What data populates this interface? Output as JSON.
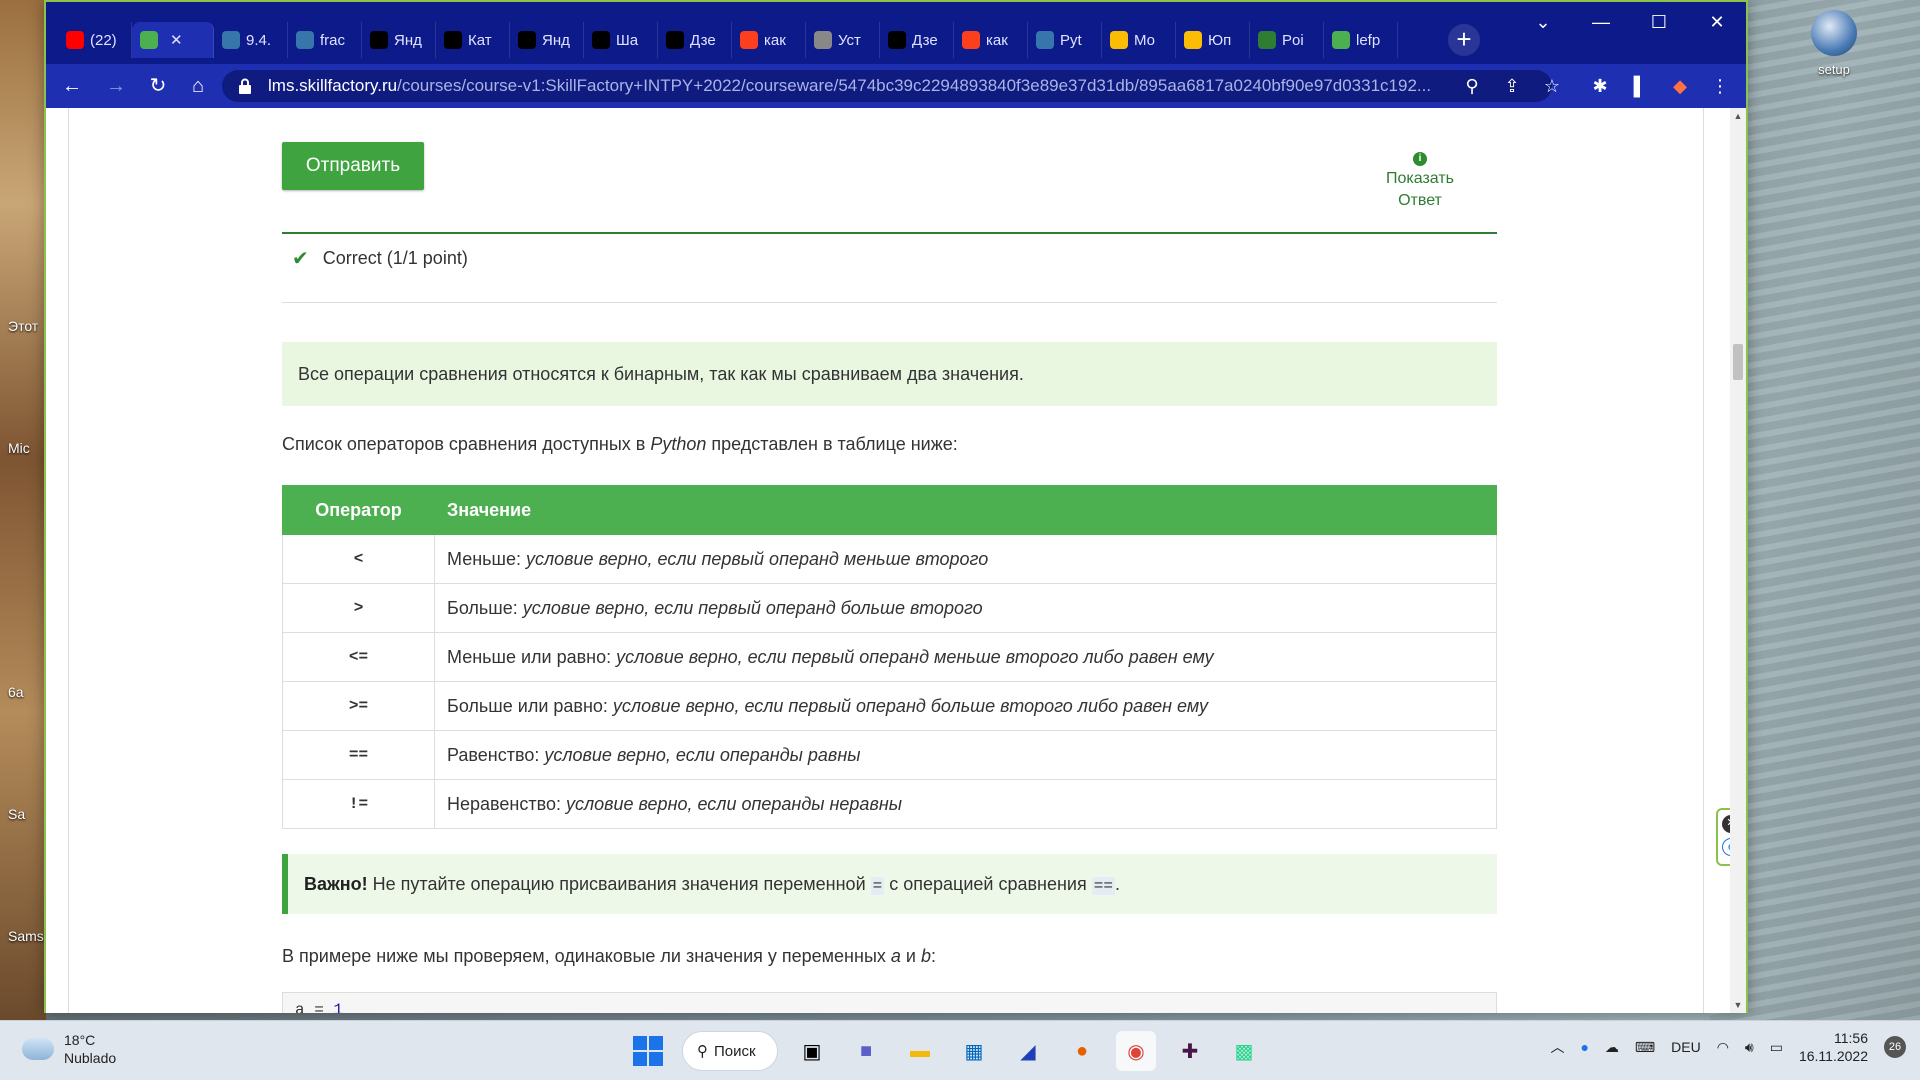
{
  "desktop": {
    "labels": [
      "Этот",
      "Mic",
      "6a",
      "Sa",
      "Sams"
    ],
    "setup_icon_label": "setup"
  },
  "browser": {
    "tabs": [
      {
        "label": "(22)",
        "icon": "youtube-icon",
        "color": "#ff0000"
      },
      {
        "label": "",
        "icon": "skillfactory-icon",
        "color": "#4caf50",
        "active": true
      },
      {
        "label": "9.4.",
        "icon": "python-icon",
        "color": "#3776ab"
      },
      {
        "label": "frac",
        "icon": "python-icon",
        "color": "#3776ab"
      },
      {
        "label": "Янд",
        "icon": "practicum-icon",
        "color": "#000000"
      },
      {
        "label": "Кат",
        "icon": "practicum-icon",
        "color": "#000000"
      },
      {
        "label": "Янд",
        "icon": "practicum-icon",
        "color": "#000000"
      },
      {
        "label": "Ша",
        "icon": "link-icon",
        "color": "#000000"
      },
      {
        "label": "Дзе",
        "icon": "dzen-icon",
        "color": "#000000"
      },
      {
        "label": "как",
        "icon": "yandex-icon",
        "color": "#fc3f1d"
      },
      {
        "label": "Уст",
        "icon": "doc-icon",
        "color": "#888888"
      },
      {
        "label": "Дзе",
        "icon": "dzen-icon",
        "color": "#000000"
      },
      {
        "label": "как",
        "icon": "yandex-icon",
        "color": "#fc3f1d"
      },
      {
        "label": "Pyt",
        "icon": "python-icon",
        "color": "#3776ab"
      },
      {
        "label": "Мо",
        "icon": "drive-icon",
        "color": "#fbbc04"
      },
      {
        "label": "Юп",
        "icon": "bulb-icon",
        "color": "#fbbc04"
      },
      {
        "label": "Poi",
        "icon": "image-icon",
        "color": "#2e7d32"
      },
      {
        "label": "lefp",
        "icon": "leaf-icon",
        "color": "#4caf50"
      }
    ],
    "url_host": "lms.skillfactory.ru",
    "url_path": "/courses/course-v1:SkillFactory+INTPY+2022/courseware/5474bc39c2294893840f3e89e37d31db/895aa6817a0240bf90e97d0331c192..."
  },
  "page": {
    "submit_label": "Отправить",
    "show_answer_label_1": "Показать",
    "show_answer_label_2": "Ответ",
    "status_text": "Correct (1/1 point)",
    "note_text": "Все операции сравнения относятся к бинарным, так как мы сравниваем два значения.",
    "intro_before": "Список операторов сравнения доступных в ",
    "intro_python": "Python",
    "intro_after": " представлен в таблице ниже:",
    "table_headers": [
      "Оператор",
      "Значение"
    ],
    "table_rows": [
      {
        "op": "<",
        "name": "Меньше: ",
        "desc": "условие верно, если первый операнд меньше второго"
      },
      {
        "op": ">",
        "name": "Больше: ",
        "desc": "условие верно, если первый операнд больше второго"
      },
      {
        "op": "<=",
        "name": "Меньше или равно: ",
        "desc": "условие верно, если первый операнд меньше второго либо равен ему"
      },
      {
        "op": ">=",
        "name": "Больше или равно: ",
        "desc": "условие верно, если первый операнд больше второго либо равен ему"
      },
      {
        "op": "==",
        "name": "Равенство: ",
        "desc": "условие верно, если операнды равны"
      },
      {
        "op": "!=",
        "name": "Неравенство: ",
        "desc": "условие верно, если операнды неравны"
      }
    ],
    "important_label": "Важно!",
    "important_text_1": " Не путайте операцию присваивания значения переменной ",
    "important_code_1": "=",
    "important_text_2": " с операцией сравнения ",
    "important_code_2": "==",
    "important_text_3": ".",
    "example_before": "В примере ниже мы проверяем, одинаковые ли значения у переменных ",
    "example_a": "a",
    "example_and": " и ",
    "example_b": "b",
    "example_after": ":",
    "code_var": "a = ",
    "code_num": "1"
  },
  "taskbar": {
    "temp": "18°C",
    "weather": "Nublado",
    "search_label": "Поиск",
    "lang": "DEU",
    "time": "11:56",
    "date": "16.11.2022",
    "notifications": "26"
  }
}
